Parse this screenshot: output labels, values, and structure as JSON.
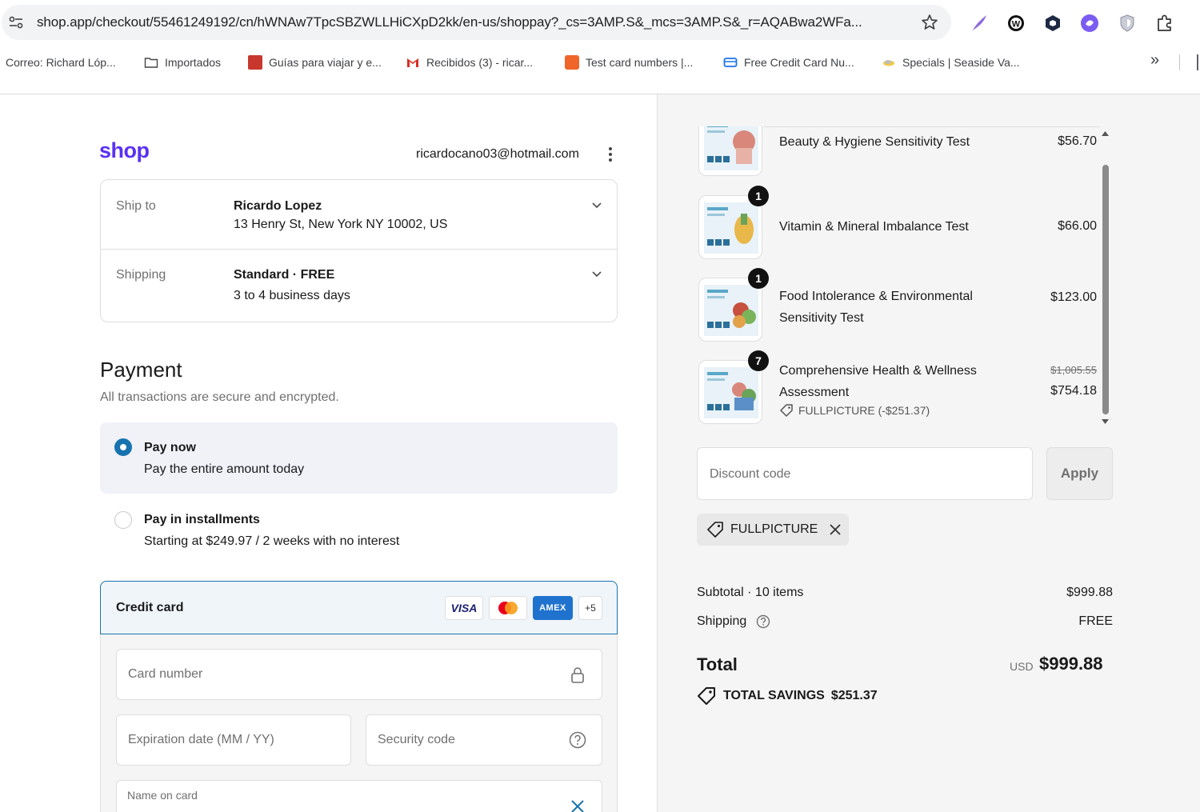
{
  "browser": {
    "url": "shop.app/checkout/55461249192/cn/hWNAw7TpcSBZWLLHiCXpD2kk/en-us/shoppay?_cs=3AMP.S&_mcs=3AMP.S&_r=AQABwa2WFa...",
    "bookmarks": [
      {
        "label": "Correo: Richard Lóp...",
        "icon": "none"
      },
      {
        "label": "Importados",
        "icon": "folder-icon"
      },
      {
        "label": "Guías para viajar y e...",
        "icon": "red-square-icon"
      },
      {
        "label": "Recibidos (3) - ricar...",
        "icon": "gmail-icon"
      },
      {
        "label": "Test card numbers |...",
        "icon": "orange-square-icon"
      },
      {
        "label": "Free Credit Card Nu...",
        "icon": "blue-card-icon"
      },
      {
        "label": "Specials | Seaside Va...",
        "icon": "cloud-icon"
      }
    ],
    "overflow_label": "»"
  },
  "header": {
    "logo": "shop",
    "email": "ricardocano03@hotmail.com"
  },
  "shipping_box": {
    "ship_to_label": "Ship to",
    "ship_to_name": "Ricardo Lopez",
    "ship_to_address": "13 Henry St, New York NY 10002, US",
    "shipping_label": "Shipping",
    "shipping_method": "Standard · FREE",
    "shipping_time": "3 to 4 business days"
  },
  "payment": {
    "title": "Payment",
    "subtitle": "All transactions are secure and encrypted.",
    "options": [
      {
        "title": "Pay now",
        "subtitle": "Pay the entire amount today",
        "selected": true
      },
      {
        "title": "Pay in installments",
        "subtitle": "Starting at $249.97 / 2 weeks with no interest",
        "selected": false
      }
    ],
    "credit_card": {
      "label": "Credit card",
      "brands": [
        "VISA",
        "mastercard",
        "AMEX"
      ],
      "more_label": "+5",
      "card_number_placeholder": "Card number",
      "expiration_placeholder": "Expiration date (MM / YY)",
      "security_placeholder": "Security code",
      "name_label": "Name on card"
    }
  },
  "cart": {
    "items": [
      {
        "name": "Beauty & Hygiene Sensitivity Test",
        "price": "$56.70",
        "qty": ""
      },
      {
        "name": "Vitamin & Mineral Imbalance Test",
        "price": "$66.00",
        "qty": "1"
      },
      {
        "name": "Food Intolerance & Environmental Sensitivity Test",
        "price": "$123.00",
        "qty": "1"
      },
      {
        "name": "Comprehensive Health & Wellness Assessment",
        "price": "$754.18",
        "old_price": "$1,005.55",
        "qty": "7",
        "discount": "FULLPICTURE (-$251.37)"
      }
    ],
    "discount_placeholder": "Discount code",
    "apply_label": "Apply",
    "applied_code": "FULLPICTURE",
    "subtotal_label": "Subtotal · 10 items",
    "subtotal_value": "$999.88",
    "shipping_label": "Shipping",
    "shipping_value": "FREE",
    "total_label": "Total",
    "currency": "USD",
    "total_value": "$999.88",
    "savings_label": "TOTAL SAVINGS",
    "savings_value": "$251.37"
  },
  "colors": {
    "shop_purple": "#5a31f4",
    "accent_blue": "#1773b0"
  }
}
